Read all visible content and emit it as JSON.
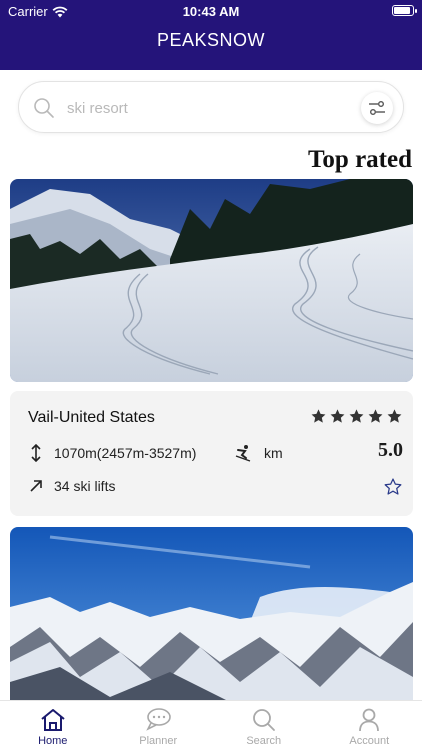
{
  "status": {
    "carrier": "Carrier",
    "time": "10:43 AM",
    "battery_level": 0.95
  },
  "app": {
    "title": "PEAKSNOW"
  },
  "search": {
    "placeholder": "ski resort",
    "value": ""
  },
  "section": {
    "title": "Top rated"
  },
  "resort": {
    "name": "Vail-United States",
    "stars": 5,
    "rating": "5.0",
    "altitude": "1070m(2457m-3527m)",
    "distance": "km",
    "lifts": "34 ski lifts"
  },
  "tabs": [
    {
      "label": "Home",
      "icon": "home-icon",
      "active": true
    },
    {
      "label": "Planner",
      "icon": "chat-icon",
      "active": false
    },
    {
      "label": "Search",
      "icon": "search-icon",
      "active": false
    },
    {
      "label": "Account",
      "icon": "account-icon",
      "active": false
    }
  ],
  "colors": {
    "header": "#24147a",
    "active_tab": "#1a1a6e",
    "inactive_tab": "#a9a9a9"
  }
}
